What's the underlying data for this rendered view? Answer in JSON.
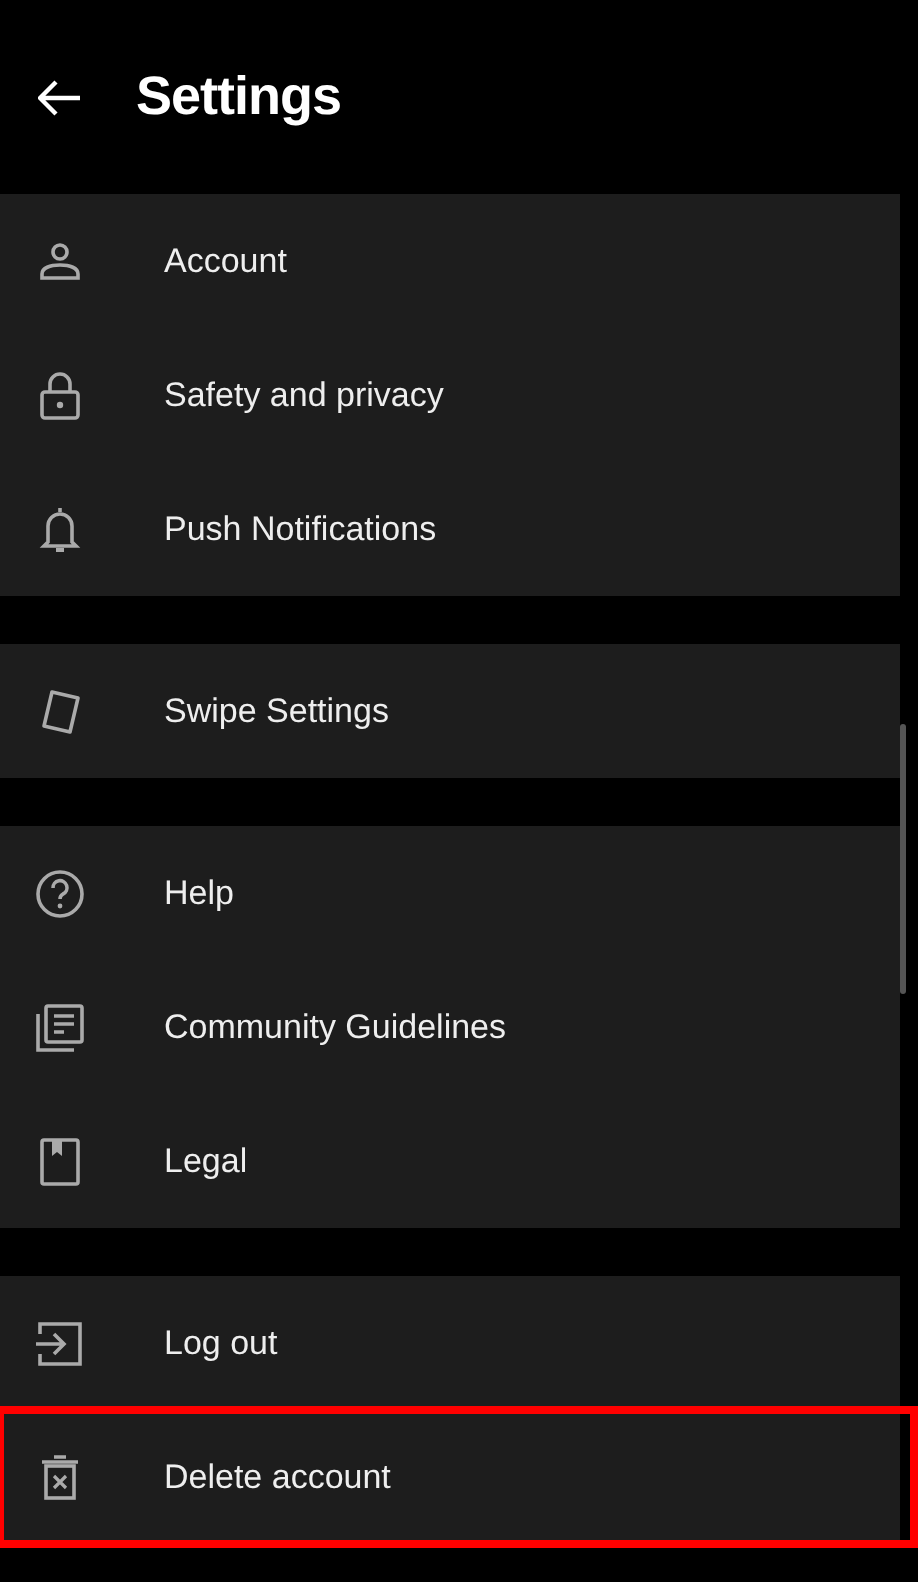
{
  "header": {
    "title": "Settings"
  },
  "sections": [
    {
      "items": [
        {
          "kind": "person",
          "label": "Account",
          "highlighted": false
        },
        {
          "kind": "lock",
          "label": "Safety and privacy",
          "highlighted": false
        },
        {
          "kind": "bell",
          "label": "Push Notifications",
          "highlighted": false
        }
      ]
    },
    {
      "items": [
        {
          "kind": "card",
          "label": "Swipe Settings",
          "highlighted": false
        }
      ]
    },
    {
      "items": [
        {
          "kind": "help",
          "label": "Help",
          "highlighted": false
        },
        {
          "kind": "document",
          "label": "Community Guidelines",
          "highlighted": false
        },
        {
          "kind": "book",
          "label": "Legal",
          "highlighted": false
        }
      ]
    },
    {
      "items": [
        {
          "kind": "logout",
          "label": "Log out",
          "highlighted": false
        },
        {
          "kind": "trash",
          "label": "Delete account",
          "highlighted": true
        }
      ]
    }
  ]
}
